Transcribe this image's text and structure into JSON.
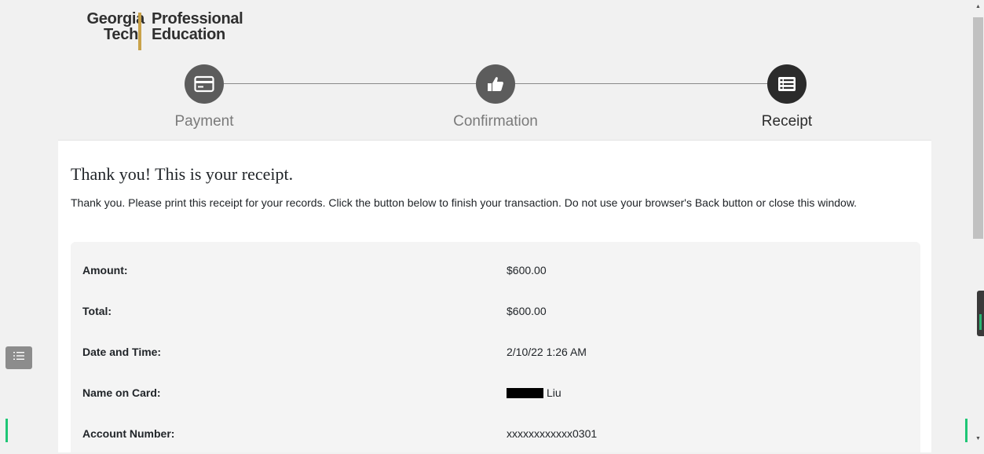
{
  "logo": {
    "line1": "Georgia",
    "line2": "Tech",
    "line3": "Professional",
    "line4": "Education"
  },
  "steps": [
    {
      "label": "Payment",
      "icon": "credit-card-icon",
      "active": false
    },
    {
      "label": "Confirmation",
      "icon": "thumbs-up-icon",
      "active": false
    },
    {
      "label": "Receipt",
      "icon": "list-icon",
      "active": true
    }
  ],
  "receipt": {
    "title": "Thank you! This is your receipt.",
    "message": "Thank you. Please print this receipt for your records. Click the button below to finish your transaction. Do not use your browser's Back button or close this window.",
    "rows": [
      {
        "key": "Amount:",
        "value": "$600.00"
      },
      {
        "key": "Total:",
        "value": "$600.00"
      },
      {
        "key": "Date and Time:",
        "value": "2/10/22 1:26 AM"
      },
      {
        "key": "Name on Card:",
        "value": "Liu",
        "redacted_prefix": true
      },
      {
        "key": "Account Number:",
        "value": "xxxxxxxxxxxx0301"
      }
    ]
  },
  "colors": {
    "page_bg": "#f1f1f1",
    "card_bg": "#ffffff",
    "details_bg": "#f4f4f4",
    "step_icon": "#5c5c5c",
    "step_icon_active": "#2b2b2b",
    "logo_accent": "#c9a24a",
    "green_accent": "#1ec675"
  }
}
